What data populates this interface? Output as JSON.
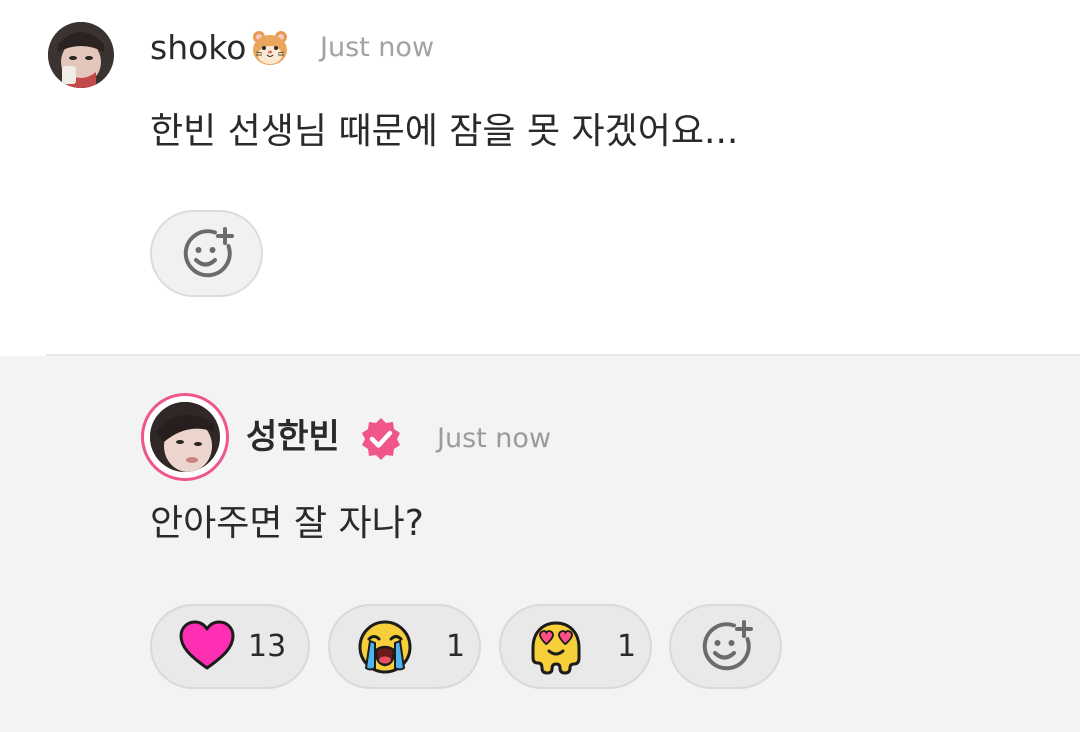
{
  "comment": {
    "author": "shoko",
    "author_emoji": "hamster-face",
    "timestamp": "Just now",
    "text": "한빈 선생님 때문에 잠을 못 자겠어요...",
    "add_reaction_icon": "smiley-plus-icon"
  },
  "reply": {
    "author": "성한빈",
    "verified_icon": "verified-badge-icon",
    "timestamp": "Just now",
    "text": "안아주면 잘 자나?",
    "reactions": [
      {
        "emoji": "pink-heart",
        "count": "13"
      },
      {
        "emoji": "crying-face",
        "count": "1"
      },
      {
        "emoji": "heart-eyes-melting-face",
        "count": "1"
      }
    ],
    "add_reaction_icon": "smiley-plus-icon"
  },
  "colors": {
    "accent_pink": "#f0558b",
    "heart": "#ff2fb4",
    "emoji_yellow": "#f6cf3a",
    "reply_background": "#f3f3f3",
    "muted_text": "#a3a3a3"
  }
}
